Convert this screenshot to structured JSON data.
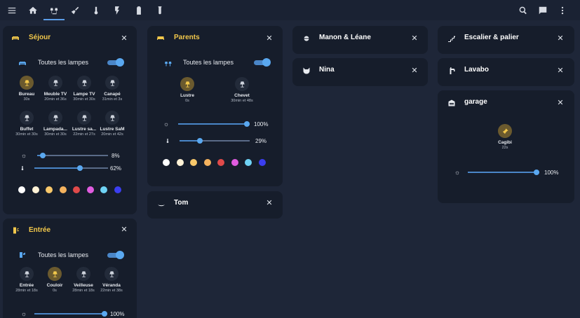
{
  "topbar": {
    "icons": [
      "menu-icon",
      "home-icon",
      "lamp-room-icon",
      "broom-icon",
      "thermometer-icon",
      "flash-icon",
      "battery-icon",
      "test-tube-icon"
    ],
    "right_icons": [
      "search-icon",
      "chat-icon",
      "more-icon"
    ]
  },
  "sejour": {
    "title": "Séjour",
    "all_lamps": "Toutes les lampes",
    "lamps": [
      {
        "name": "Bureau",
        "time": "30s",
        "on": true
      },
      {
        "name": "Meuble TV",
        "time": "20min et 36s",
        "on": false
      },
      {
        "name": "Lampe TV",
        "time": "30min et 30s",
        "on": false
      },
      {
        "name": "Canapé",
        "time": "31min et 3s",
        "on": false
      },
      {
        "name": "Buffet",
        "time": "30min et 30s",
        "on": false
      },
      {
        "name": "Lampada...",
        "time": "30min et 30s",
        "on": false
      },
      {
        "name": "Lustre sa...",
        "time": "22min et 27s",
        "on": false
      },
      {
        "name": "Lustre SaM",
        "time": "20min et 42s",
        "on": false
      }
    ],
    "brightness": "8%",
    "temperature": "62%",
    "brightness_value": 0.08,
    "temperature_value": 0.62
  },
  "entree": {
    "title": "Entrée",
    "all_lamps": "Toutes les lampes",
    "lamps": [
      {
        "name": "Entrée",
        "time": "28min et 18s",
        "on": false
      },
      {
        "name": "Couloir",
        "time": "0s",
        "on": true
      },
      {
        "name": "Veilleuse",
        "time": "28min et 18s",
        "on": false
      },
      {
        "name": "Véranda",
        "time": "22min et 38s",
        "on": false
      }
    ],
    "brightness": "100%",
    "brightness_value": 1.0
  },
  "parents": {
    "title": "Parents",
    "all_lamps": "Toutes les lampes",
    "lamps": [
      {
        "name": "Lustre",
        "time": "0s",
        "on": true
      },
      {
        "name": "Chevet",
        "time": "30min et 48s",
        "on": false
      }
    ],
    "brightness": "100%",
    "temperature": "29%",
    "brightness_value": 1.0,
    "temperature_value": 0.29
  },
  "tom": {
    "title": "Tom"
  },
  "manon": {
    "title": "Manon & Léane"
  },
  "nina": {
    "title": "Nina"
  },
  "escalier": {
    "title": "Escalier & palier"
  },
  "lavabo": {
    "title": "Lavabo"
  },
  "garage": {
    "title": "garage",
    "lamp": {
      "name": "Cagibi",
      "time": "22s",
      "on": true
    },
    "brightness": "100%",
    "brightness_value": 1.0
  },
  "close_symbol": "✕",
  "colors": {
    "swatches": [
      "#ffffff",
      "#fff2d6",
      "#f8c86b",
      "#f4b25e",
      "#e04a4a",
      "#e05ce0",
      "#6fd3f5",
      "#3b3ef0"
    ],
    "accent": "#5aa8f0",
    "title_yellow": "#f2c84b"
  }
}
